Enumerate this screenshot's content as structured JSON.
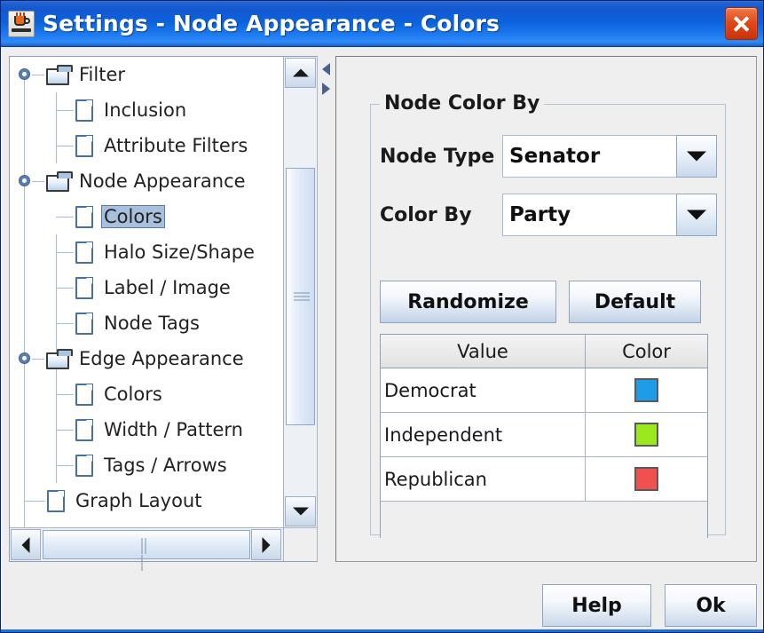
{
  "window": {
    "title": "Settings - Node Appearance - Colors",
    "icon": "java-coffee-cup-icon",
    "close_label": "",
    "titlebar_color": "#1458CE",
    "close_color": "#E04A1A"
  },
  "tree": {
    "items": [
      {
        "label": "Filter",
        "type": "folder",
        "depth": 0,
        "expanded": true,
        "selected": false
      },
      {
        "label": "Inclusion",
        "type": "leaf",
        "depth": 1,
        "expanded": false,
        "selected": false
      },
      {
        "label": "Attribute Filters",
        "type": "leaf",
        "depth": 1,
        "expanded": false,
        "selected": false
      },
      {
        "label": "Node Appearance",
        "type": "folder",
        "depth": 0,
        "expanded": true,
        "selected": false
      },
      {
        "label": "Colors",
        "type": "leaf",
        "depth": 1,
        "expanded": false,
        "selected": true
      },
      {
        "label": "Halo Size/Shape",
        "type": "leaf",
        "depth": 1,
        "expanded": false,
        "selected": false
      },
      {
        "label": "Label / Image",
        "type": "leaf",
        "depth": 1,
        "expanded": false,
        "selected": false
      },
      {
        "label": "Node Tags",
        "type": "leaf",
        "depth": 1,
        "expanded": false,
        "selected": false
      },
      {
        "label": "Edge Appearance",
        "type": "folder",
        "depth": 0,
        "expanded": true,
        "selected": false
      },
      {
        "label": "Colors",
        "type": "leaf",
        "depth": 1,
        "expanded": false,
        "selected": false
      },
      {
        "label": "Width / Pattern",
        "type": "leaf",
        "depth": 1,
        "expanded": false,
        "selected": false
      },
      {
        "label": "Tags / Arrows",
        "type": "leaf",
        "depth": 1,
        "expanded": false,
        "selected": false
      },
      {
        "label": "Graph Layout",
        "type": "leaf",
        "depth": 0,
        "expanded": false,
        "selected": false
      }
    ],
    "selection_color": "#A8C0DC"
  },
  "panel": {
    "group_title": "Node Color By",
    "node_type": {
      "label": "Node Type",
      "value": "Senator"
    },
    "color_by": {
      "label": "Color By",
      "value": "Party"
    },
    "randomize_label": "Randomize",
    "default_label": "Default",
    "table": {
      "headers": [
        "Value",
        "Color"
      ],
      "rows": [
        {
          "value": "Democrat",
          "color": "#1E9CE8"
        },
        {
          "value": "Independent",
          "color": "#9CE81E"
        },
        {
          "value": "Republican",
          "color": "#F05050"
        }
      ]
    }
  },
  "footer": {
    "help_label": "Help",
    "ok_label": "Ok"
  }
}
